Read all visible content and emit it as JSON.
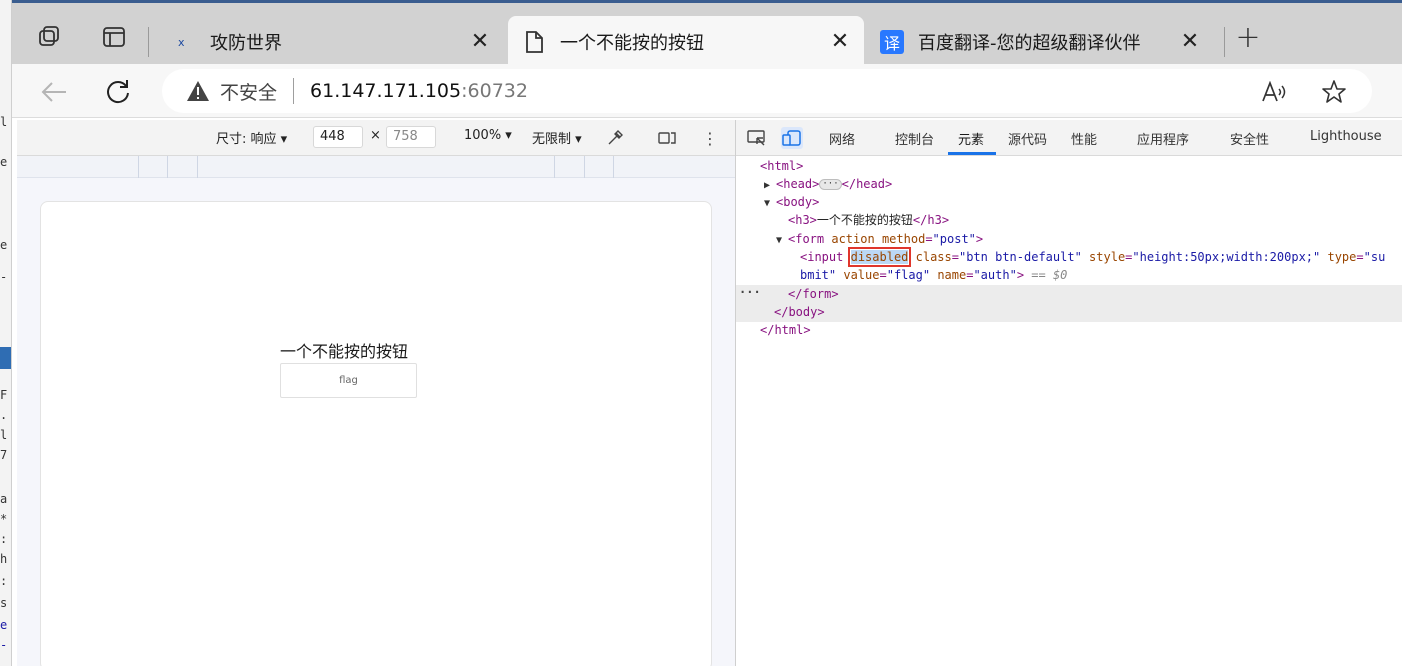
{
  "browser": {
    "tabs": [
      {
        "title": "攻防世界",
        "icon": "xctf-favicon",
        "active": false
      },
      {
        "title": "一个不能按的按钮",
        "icon": "page-icon",
        "active": true
      },
      {
        "title": "百度翻译-您的超级翻译伙伴",
        "icon": "translate-favicon",
        "favicon_text": "译",
        "active": false
      }
    ],
    "tab_close_symbol": "✕",
    "new_tab_symbol": "+",
    "address": {
      "security_label": "不安全",
      "host": "61.147.171.105",
      "port": ":60732"
    }
  },
  "device_toolbar": {
    "dimensions_label": "尺寸: 响应",
    "width": "448",
    "times": "×",
    "height_placeholder": "758",
    "zoom": "100%",
    "throttle": "无限制"
  },
  "page": {
    "heading": "一个不能按的按钮",
    "button_label": "flag"
  },
  "devtools": {
    "tabs": [
      "网络",
      "控制台",
      "元素",
      "源代码",
      "性能",
      "应用程序",
      "安全性",
      "Lighthouse"
    ],
    "active_tab": "元素",
    "code": {
      "l1": "<html>",
      "l2_open": "<head>",
      "l2_close": "</head>",
      "l3": "<body>",
      "l4_open": "<h3>",
      "l4_text": "一个不能按的按钮",
      "l4_close": "</h3>",
      "l5_tag": "<form",
      "l5_attr1": "action",
      "l5_attr2": "method",
      "l5_val2": "\"post\"",
      "l5_end": ">",
      "l6_tag": "<input",
      "l6_disabled": "disabled",
      "l6_class_attr": "class",
      "l6_class_val": "\"btn btn-default\"",
      "l6_style_attr": "style",
      "l6_style_val": "\"height:50px;width:200px;\"",
      "l6_type_attr": "type",
      "l6_type_val_a": "\"su",
      "l6_type_val_b": "bmit\"",
      "l6_value_attr": "value",
      "l6_value_val": "\"flag\"",
      "l6_name_attr": "name",
      "l6_name_val": "\"auth\"",
      "l6_end": ">",
      "l6_ref": "== $0",
      "l7": "</form>",
      "l8": "</body>",
      "l9": "</html>"
    }
  }
}
